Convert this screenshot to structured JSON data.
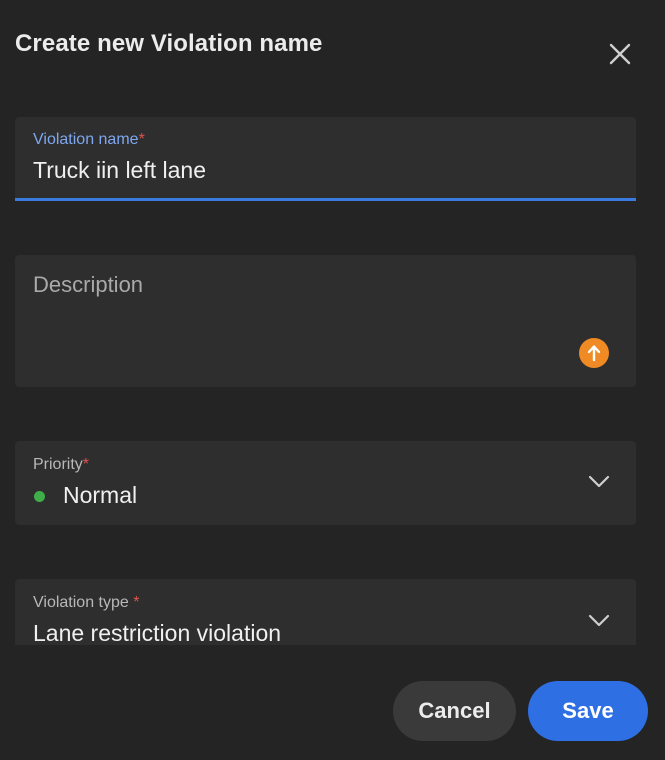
{
  "dialog": {
    "title": "Create new Violation name"
  },
  "fields": {
    "violation_name": {
      "label": "Violation name",
      "required_mark": "*",
      "value": "Truck iin left lane"
    },
    "description": {
      "placeholder": "Description"
    },
    "priority": {
      "label": "Priority",
      "required_mark": "*",
      "value": "Normal",
      "status_color": "#3fae4a"
    },
    "violation_type": {
      "label": "Violation type",
      "required_mark": " *",
      "value": "Lane restriction violation"
    }
  },
  "actions": {
    "cancel_label": "Cancel",
    "save_label": "Save"
  },
  "colors": {
    "accent": "#2f6fe4",
    "focus_underline": "#3a7be0",
    "required": "#e0524f",
    "grammar_badge": "#f08a24"
  },
  "icons": {
    "close": "close-icon",
    "grammar": "grammar-upload-icon",
    "dropdown": "chevron-down-icon"
  }
}
